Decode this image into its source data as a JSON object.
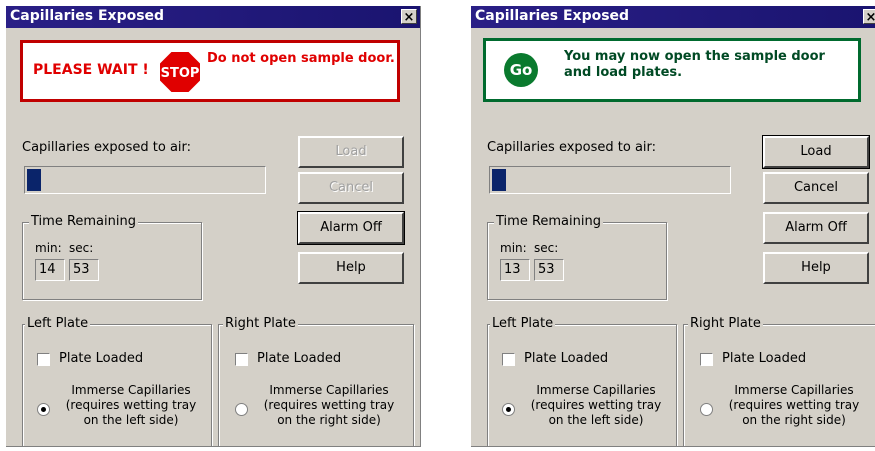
{
  "dialogs": [
    {
      "title": "Capillaries Exposed",
      "close": "×",
      "banner": {
        "type": "stop",
        "wait_text": "PLEASE WAIT !",
        "sign_text": "STOP",
        "message": "Do not open sample door."
      },
      "capillaries_label": "Capillaries exposed to air:",
      "progress_fraction": 0.06,
      "buttons": {
        "load": "Load",
        "cancel": "Cancel",
        "alarm_off": "Alarm Off",
        "help": "Help"
      },
      "load_enabled": false,
      "cancel_enabled": false,
      "time_remaining": {
        "label": "Time Remaining",
        "min_label": "min:",
        "sec_label": "sec:",
        "min": "14",
        "sec": "53"
      },
      "left_plate": {
        "label": "Left Plate",
        "plate_loaded": "Plate Loaded",
        "immerse": "Immerse Capillaries",
        "immerse_sub1": "(requires wetting tray",
        "immerse_sub2": "on the left side)"
      },
      "right_plate": {
        "label": "Right Plate",
        "plate_loaded": "Plate Loaded",
        "immerse": "Immerse Capillaries",
        "immerse_sub1": "(requires wetting tray",
        "immerse_sub2": "on the right side)"
      }
    },
    {
      "title": "Capillaries Exposed",
      "close": "×",
      "banner": {
        "type": "go",
        "sign_text": "Go",
        "message": "You may now open the sample door and load plates."
      },
      "capillaries_label": "Capillaries exposed to air:",
      "progress_fraction": 0.06,
      "buttons": {
        "load": "Load",
        "cancel": "Cancel",
        "alarm_off": "Alarm Off",
        "help": "Help"
      },
      "load_enabled": true,
      "cancel_enabled": true,
      "time_remaining": {
        "label": "Time Remaining",
        "min_label": "min:",
        "sec_label": "sec:",
        "min": "13",
        "sec": "53"
      },
      "left_plate": {
        "label": "Left Plate",
        "plate_loaded": "Plate Loaded",
        "immerse": "Immerse Capillaries",
        "immerse_sub1": "(requires wetting tray",
        "immerse_sub2": "on the left side)"
      },
      "right_plate": {
        "label": "Right Plate",
        "plate_loaded": "Plate Loaded",
        "immerse": "Immerse Capillaries",
        "immerse_sub1": "(requires wetting tray",
        "immerse_sub2": "on the right side)"
      }
    }
  ],
  "colors": {
    "title_bar": "#2a1f86",
    "stop_red": "#e00000",
    "go_green": "#0a7a2e",
    "progress_fill": "#0a246a",
    "dialog_bg": "#d4d0c8"
  }
}
